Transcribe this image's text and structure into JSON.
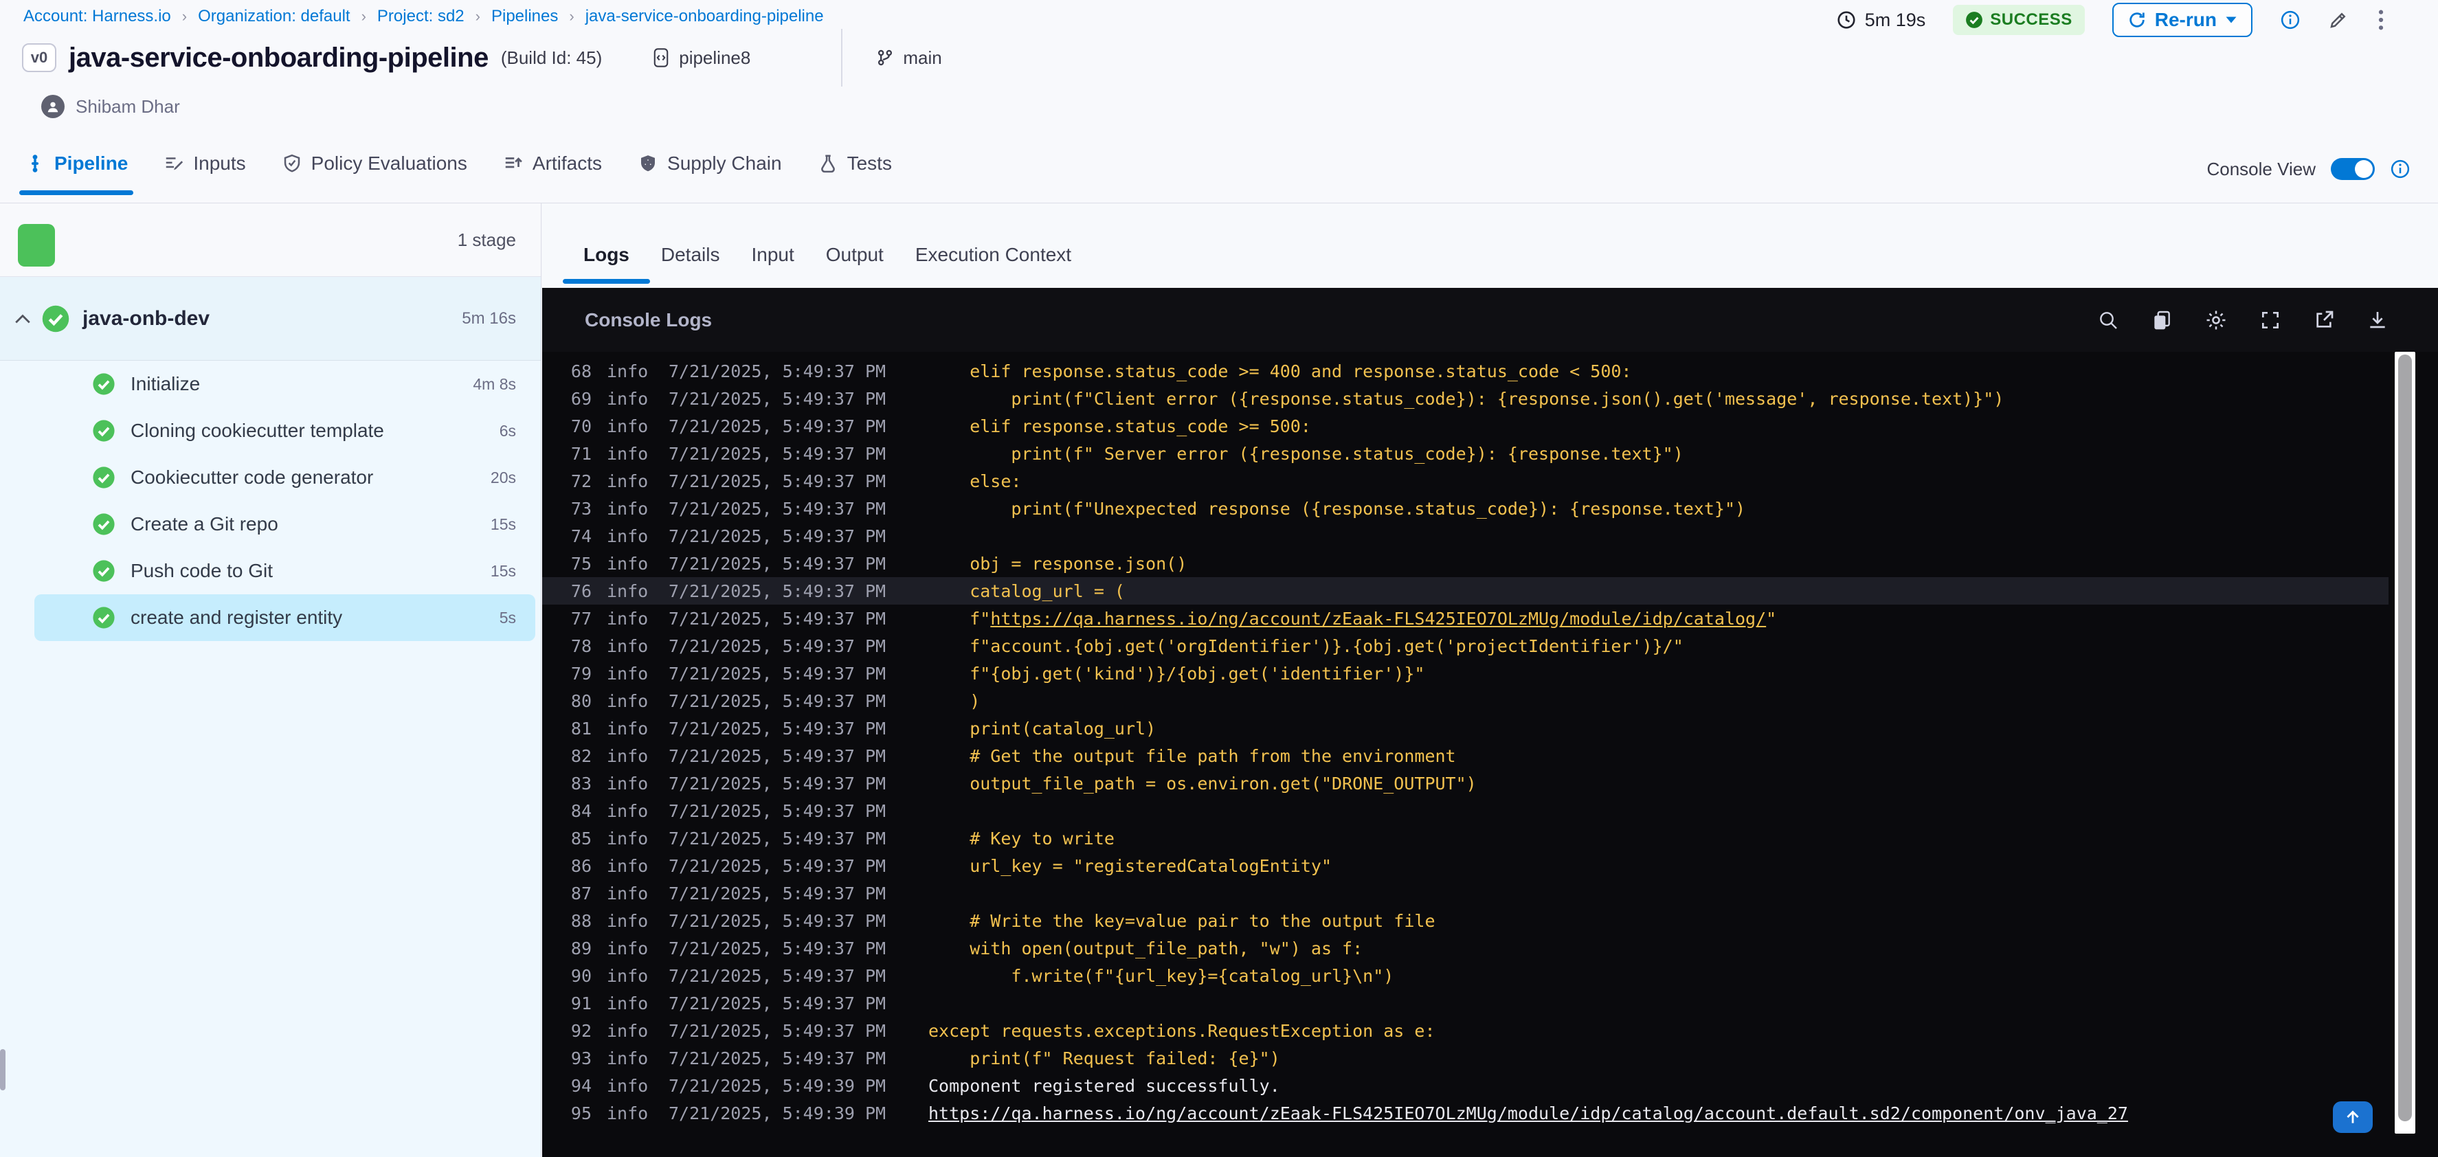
{
  "breadcrumb": {
    "separator": "›",
    "items": [
      "Account: Harness.io",
      "Organization: default",
      "Project: sd2",
      "Pipelines",
      "java-service-onboarding-pipeline"
    ]
  },
  "header": {
    "duration": "5m 19s",
    "status": "SUCCESS",
    "rerun_label": "Re-run",
    "version_badge": "v0",
    "title": "java-service-onboarding-pipeline",
    "build_id": "(Build Id: 45)",
    "pipeline_ref": "pipeline8",
    "branch": "main",
    "author": "Shibam Dhar",
    "action_icons": [
      "info-icon",
      "edit-pencil-icon",
      "kebab-menu-icon"
    ]
  },
  "main_tabs": [
    {
      "label": "Pipeline",
      "icon": "pipeline-icon",
      "active": true
    },
    {
      "label": "Inputs",
      "icon": "inputs-icon",
      "active": false
    },
    {
      "label": "Policy Evaluations",
      "icon": "policy-evaluations-icon",
      "active": false
    },
    {
      "label": "Artifacts",
      "icon": "artifacts-icon",
      "active": false
    },
    {
      "label": "Supply Chain",
      "icon": "supply-chain-icon",
      "active": false
    },
    {
      "label": "Tests",
      "icon": "tests-icon",
      "active": false
    }
  ],
  "console_view": {
    "label": "Console View",
    "enabled": true
  },
  "sidebar": {
    "stage_count_label": "1 stage",
    "stage": {
      "name": "java-onb-dev",
      "duration": "5m 16s",
      "status": "success"
    },
    "steps": [
      {
        "label": "Initialize",
        "duration": "4m 8s",
        "selected": false
      },
      {
        "label": "Cloning cookiecutter template",
        "duration": "6s",
        "selected": false
      },
      {
        "label": "Cookiecutter code generator",
        "duration": "20s",
        "selected": false
      },
      {
        "label": "Create a Git repo",
        "duration": "15s",
        "selected": false
      },
      {
        "label": "Push code to Git",
        "duration": "15s",
        "selected": false
      },
      {
        "label": "create and register entity",
        "duration": "5s",
        "selected": true
      }
    ]
  },
  "log_panel": {
    "tabs": [
      {
        "label": "Logs",
        "active": true
      },
      {
        "label": "Details",
        "active": false
      },
      {
        "label": "Input",
        "active": false
      },
      {
        "label": "Output",
        "active": false
      },
      {
        "label": "Execution Context",
        "active": false
      }
    ],
    "title": "Console Logs",
    "toolbar_icons": [
      "search-icon",
      "copy-icon",
      "settings-gear-icon",
      "fullscreen-icon",
      "open-in-new-icon",
      "download-icon"
    ],
    "accent_color": "#F2C14F",
    "date": "7/21/2025"
  },
  "logs": {
    "rows": [
      {
        "n": 68,
        "level": "info",
        "time": "5:49:37 PM",
        "indent": 4,
        "kind": "code",
        "segments": [
          {
            "t": "elif response.status_code >= 400 and response.status_code < 500:"
          }
        ]
      },
      {
        "n": 69,
        "level": "info",
        "time": "5:49:37 PM",
        "indent": 8,
        "kind": "code",
        "segments": [
          {
            "t": "print(f\"Client error ({response.status_code}): {response.json().get('message', response.text)}\")"
          }
        ]
      },
      {
        "n": 70,
        "level": "info",
        "time": "5:49:37 PM",
        "indent": 4,
        "kind": "code",
        "segments": [
          {
            "t": "elif response.status_code >= 500:"
          }
        ]
      },
      {
        "n": 71,
        "level": "info",
        "time": "5:49:37 PM",
        "indent": 8,
        "kind": "code",
        "segments": [
          {
            "t": "print(f\" Server error ({response.status_code}): {response.text}\")"
          }
        ]
      },
      {
        "n": 72,
        "level": "info",
        "time": "5:49:37 PM",
        "indent": 4,
        "kind": "code",
        "segments": [
          {
            "t": "else:"
          }
        ]
      },
      {
        "n": 73,
        "level": "info",
        "time": "5:49:37 PM",
        "indent": 8,
        "kind": "code",
        "segments": [
          {
            "t": "print(f\"Unexpected response ({response.status_code}): {response.text}\")"
          }
        ]
      },
      {
        "n": 74,
        "level": "info",
        "time": "5:49:37 PM",
        "indent": 0,
        "kind": "code",
        "segments": []
      },
      {
        "n": 75,
        "level": "info",
        "time": "5:49:37 PM",
        "indent": 4,
        "kind": "code",
        "segments": [
          {
            "t": "obj = response.json()"
          }
        ]
      },
      {
        "n": 76,
        "level": "info",
        "time": "5:49:37 PM",
        "indent": 4,
        "kind": "code",
        "highlight": true,
        "segments": [
          {
            "t": "catalog_url = ("
          }
        ]
      },
      {
        "n": 77,
        "level": "info",
        "time": "5:49:37 PM",
        "indent": 4,
        "kind": "code",
        "segments": [
          {
            "t": "f\""
          },
          {
            "t": "https://qa.harness.io/ng/account/zEaak-FLS425IEO7OLzMUg/module/idp/catalog/",
            "u": true
          },
          {
            "t": "\""
          }
        ]
      },
      {
        "n": 78,
        "level": "info",
        "time": "5:49:37 PM",
        "indent": 4,
        "kind": "code",
        "segments": [
          {
            "t": "f\"account.{obj.get('orgIdentifier')}.{obj.get('projectIdentifier')}/\""
          }
        ]
      },
      {
        "n": 79,
        "level": "info",
        "time": "5:49:37 PM",
        "indent": 4,
        "kind": "code",
        "segments": [
          {
            "t": "f\"{obj.get('kind')}/{obj.get('identifier')}\""
          }
        ]
      },
      {
        "n": 80,
        "level": "info",
        "time": "5:49:37 PM",
        "indent": 4,
        "kind": "code",
        "segments": [
          {
            "t": ")"
          }
        ]
      },
      {
        "n": 81,
        "level": "info",
        "time": "5:49:37 PM",
        "indent": 4,
        "kind": "code",
        "segments": [
          {
            "t": "print(catalog_url)"
          }
        ]
      },
      {
        "n": 82,
        "level": "info",
        "time": "5:49:37 PM",
        "indent": 4,
        "kind": "code",
        "segments": [
          {
            "t": "# Get the output file path from the environment"
          }
        ]
      },
      {
        "n": 83,
        "level": "info",
        "time": "5:49:37 PM",
        "indent": 4,
        "kind": "code",
        "segments": [
          {
            "t": "output_file_path = os.environ.get(\"DRONE_OUTPUT\")"
          }
        ]
      },
      {
        "n": 84,
        "level": "info",
        "time": "5:49:37 PM",
        "indent": 0,
        "kind": "code",
        "segments": []
      },
      {
        "n": 85,
        "level": "info",
        "time": "5:49:37 PM",
        "indent": 4,
        "kind": "code",
        "segments": [
          {
            "t": "# Key to write"
          }
        ]
      },
      {
        "n": 86,
        "level": "info",
        "time": "5:49:37 PM",
        "indent": 4,
        "kind": "code",
        "segments": [
          {
            "t": "url_key = \"registeredCatalogEntity\""
          }
        ]
      },
      {
        "n": 87,
        "level": "info",
        "time": "5:49:37 PM",
        "indent": 0,
        "kind": "code",
        "segments": []
      },
      {
        "n": 88,
        "level": "info",
        "time": "5:49:37 PM",
        "indent": 4,
        "kind": "code",
        "segments": [
          {
            "t": "# Write the key=value pair to the output file"
          }
        ]
      },
      {
        "n": 89,
        "level": "info",
        "time": "5:49:37 PM",
        "indent": 4,
        "kind": "code",
        "segments": [
          {
            "t": "with open(output_file_path, \"w\") as f:"
          }
        ]
      },
      {
        "n": 90,
        "level": "info",
        "time": "5:49:37 PM",
        "indent": 8,
        "kind": "code",
        "segments": [
          {
            "t": "f.write(f\"{url_key}={catalog_url}\\n\")"
          }
        ]
      },
      {
        "n": 91,
        "level": "info",
        "time": "5:49:37 PM",
        "indent": 0,
        "kind": "code",
        "segments": []
      },
      {
        "n": 92,
        "level": "info",
        "time": "5:49:37 PM",
        "indent": 0,
        "kind": "code",
        "segments": [
          {
            "t": "except requests.exceptions.RequestException as e:"
          }
        ]
      },
      {
        "n": 93,
        "level": "info",
        "time": "5:49:37 PM",
        "indent": 4,
        "kind": "code",
        "segments": [
          {
            "t": "print(f\" Request failed: {e}\")"
          }
        ]
      },
      {
        "n": 94,
        "level": "info",
        "time": "5:49:39 PM",
        "indent": 0,
        "kind": "plain",
        "segments": [
          {
            "t": "Component registered successfully."
          }
        ]
      },
      {
        "n": 95,
        "level": "info",
        "time": "5:49:39 PM",
        "indent": 0,
        "kind": "plain",
        "segments": [
          {
            "t": "https://qa.harness.io/ng/account/zEaak-FLS425IEO7OLzMUg/module/idp/catalog/account.default.sd2/component/onv_java_27",
            "u": true
          }
        ]
      }
    ]
  },
  "colors": {
    "accent_blue": "#0278D5",
    "success_green": "#4CC15A",
    "log_code_yellow": "#F2C14F",
    "console_bg": "#0A0A0D",
    "selected_step_bg": "#C6EDFD"
  }
}
